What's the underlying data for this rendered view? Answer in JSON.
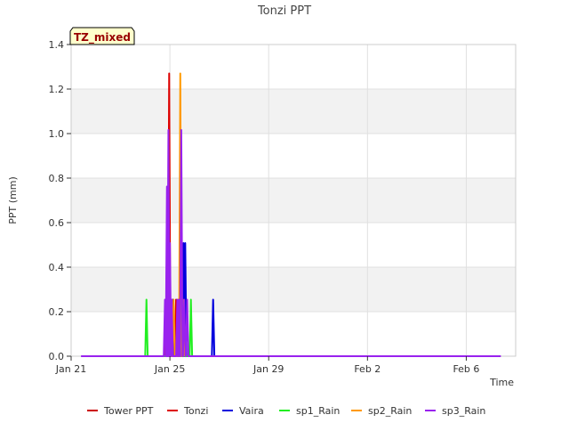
{
  "chart_data": {
    "type": "line",
    "title": "Tonzi PPT",
    "badge": "TZ_mixed",
    "xlabel": "Time",
    "ylabel": "PPT (mm)",
    "x_start": "Jan 21",
    "xlim_days": [
      0,
      18.0
    ],
    "ylim": [
      0,
      1.4
    ],
    "x_ticks": [
      {
        "day": 0,
        "label": "Jan 21"
      },
      {
        "day": 4,
        "label": "Jan 25"
      },
      {
        "day": 8,
        "label": "Jan 29"
      },
      {
        "day": 12,
        "label": "Feb 2"
      },
      {
        "day": 16,
        "label": "Feb 6"
      }
    ],
    "y_ticks": [
      0.0,
      0.2,
      0.4,
      0.6,
      0.8,
      1.0,
      1.2,
      1.4
    ],
    "y_tick_labels": [
      "0.0",
      "0.2",
      "0.4",
      "0.6",
      "0.8",
      "1.0",
      "1.2",
      "1.4"
    ],
    "grid": true,
    "legend_position": "bottom",
    "series": [
      {
        "name": "Tower PPT",
        "color": "#cc0000",
        "points": []
      },
      {
        "name": "Tonzi",
        "color": "#dd0000",
        "points": [
          [
            3.83,
            0.254
          ],
          [
            3.9,
            0.254
          ],
          [
            3.97,
            1.27
          ],
          [
            4.05,
            0.254
          ],
          [
            4.25,
            0.254
          ],
          [
            4.45,
            0.254
          ]
        ]
      },
      {
        "name": "Vaira",
        "color": "#0000dd",
        "points": [
          [
            4.12,
            0.254
          ],
          [
            4.55,
            0.508
          ],
          [
            4.62,
            0.508
          ],
          [
            5.75,
            0.254
          ]
        ]
      },
      {
        "name": "sp1_Rain",
        "color": "#22ee22",
        "points": [
          [
            3.05,
            0.254
          ],
          [
            4.85,
            0.254
          ]
        ]
      },
      {
        "name": "sp2_Rain",
        "color": "#ff9900",
        "points": [
          [
            3.93,
            0.254
          ],
          [
            4.15,
            0.254
          ],
          [
            4.33,
            0.254
          ],
          [
            4.42,
            1.27
          ],
          [
            4.52,
            0.254
          ]
        ]
      },
      {
        "name": "sp3_Rain",
        "color": "#9922ee",
        "points": [
          [
            0.4,
            0
          ],
          [
            3.8,
            0.254
          ],
          [
            3.88,
            0.762
          ],
          [
            3.94,
            1.016
          ],
          [
            4.0,
            0.508
          ],
          [
            4.07,
            0.254
          ],
          [
            4.3,
            0.254
          ],
          [
            4.37,
            0.254
          ],
          [
            4.46,
            1.016
          ],
          [
            4.58,
            0.254
          ],
          [
            4.7,
            0.254
          ],
          [
            17.4,
            0
          ]
        ]
      }
    ]
  }
}
